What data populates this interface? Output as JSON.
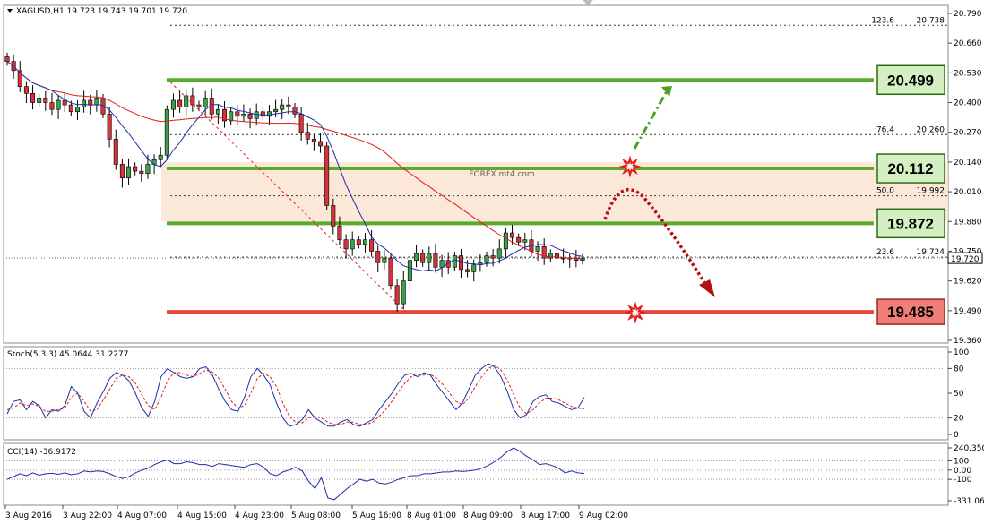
{
  "chart_data": [
    {
      "type": "candlestick",
      "symbol": "XAGUSD,H1",
      "ohlc": "19.723 19.743 19.701 19.720",
      "ylim": [
        19.36,
        20.79
      ],
      "y_ticks": [
        "20.790",
        "20.660",
        "20.530",
        "20.400",
        "20.270",
        "20.140",
        "20.010",
        "19.880",
        "19.750",
        "19.620",
        "19.490",
        "19.360"
      ],
      "x_ticks": [
        "3 Aug 2016",
        "3 Aug 22:00",
        "4 Aug 07:00",
        "4 Aug 15:00",
        "4 Aug 23:00",
        "5 Aug 08:00",
        "5 Aug 16:00",
        "8 Aug 01:00",
        "8 Aug 09:00",
        "8 Aug 17:00",
        "9 Aug 02:00"
      ],
      "current_price": "19.720",
      "fib_levels": [
        {
          "ratio": "123.6",
          "price": "20.738",
          "value": 20.738
        },
        {
          "ratio": "76.4",
          "price": "20.260",
          "value": 20.26
        },
        {
          "ratio": "50.0",
          "price": "19.992",
          "value": 19.992
        },
        {
          "ratio": "23.6",
          "price": "19.724",
          "value": 19.724
        }
      ],
      "resistance_levels": [
        {
          "label": "20.499",
          "value": 20.499,
          "color": "#5aaa2e"
        },
        {
          "label": "20.112",
          "value": 20.112,
          "color": "#5aaa2e"
        },
        {
          "label": "19.872",
          "value": 19.872,
          "color": "#5aaa2e"
        }
      ],
      "support_levels": [
        {
          "label": "19.485",
          "value": 19.485,
          "color": "#e8463e"
        }
      ],
      "zone": [
        19.88,
        20.14
      ],
      "watermark": "FOREX mt4.com",
      "closes": [
        20.58,
        20.54,
        20.47,
        20.44,
        20.4,
        20.42,
        20.4,
        20.37,
        20.41,
        20.39,
        20.36,
        20.38,
        20.41,
        20.39,
        20.42,
        20.35,
        20.24,
        20.13,
        20.07,
        20.12,
        20.1,
        20.09,
        20.13,
        20.15,
        20.17,
        20.37,
        20.41,
        20.38,
        20.43,
        20.39,
        20.38,
        20.42,
        20.35,
        20.37,
        20.32,
        20.36,
        20.34,
        20.35,
        20.33,
        20.36,
        20.34,
        20.36,
        20.37,
        20.39,
        20.38,
        20.35,
        20.27,
        20.24,
        20.23,
        20.21,
        19.95,
        19.86,
        19.8,
        19.76,
        19.8,
        19.78,
        19.8,
        19.75,
        19.7,
        19.72,
        19.6,
        19.52,
        19.62,
        19.71,
        19.74,
        19.7,
        19.74,
        19.68,
        19.71,
        19.68,
        19.73,
        19.67,
        19.66,
        19.69,
        19.7,
        19.73,
        19.72,
        19.76,
        19.83,
        19.81,
        19.79,
        19.8,
        19.75,
        19.77,
        19.72,
        19.74,
        19.72,
        19.72,
        19.72,
        19.71,
        19.72
      ],
      "stoch_label": "Stoch(5,3,3) 45.0644 31.2277",
      "stoch_ticks": [
        "100",
        "80",
        "50",
        "20",
        "0"
      ],
      "stoch_main": [
        25,
        40,
        42,
        30,
        40,
        35,
        20,
        30,
        28,
        35,
        58,
        50,
        28,
        20,
        38,
        52,
        68,
        75,
        72,
        65,
        50,
        32,
        22,
        40,
        70,
        80,
        75,
        70,
        68,
        70,
        80,
        82,
        72,
        55,
        40,
        30,
        28,
        45,
        70,
        80,
        72,
        60,
        38,
        20,
        10,
        12,
        18,
        30,
        20,
        15,
        10,
        10,
        15,
        18,
        12,
        10,
        14,
        18,
        30,
        40,
        50,
        62,
        72,
        74,
        70,
        75,
        72,
        60,
        50,
        40,
        30,
        38,
        55,
        72,
        80,
        86,
        82,
        70,
        52,
        30,
        20,
        24,
        40,
        46,
        48,
        40,
        38,
        34,
        30,
        32,
        45
      ],
      "stoch_signal": [
        30,
        32,
        38,
        35,
        37,
        34,
        28,
        28,
        30,
        32,
        45,
        50,
        40,
        28,
        30,
        42,
        55,
        68,
        72,
        70,
        62,
        48,
        35,
        30,
        45,
        65,
        75,
        75,
        72,
        70,
        74,
        78,
        76,
        68,
        55,
        40,
        32,
        35,
        50,
        68,
        74,
        70,
        58,
        38,
        22,
        15,
        14,
        20,
        22,
        20,
        15,
        12,
        12,
        15,
        15,
        12,
        12,
        15,
        22,
        30,
        40,
        52,
        62,
        70,
        72,
        72,
        73,
        68,
        60,
        50,
        40,
        36,
        44,
        58,
        70,
        80,
        84,
        78,
        66,
        48,
        32,
        25,
        30,
        38,
        44,
        44,
        42,
        38,
        34,
        32,
        31
      ],
      "cci_label": "CCI(14) -36.9172",
      "cci_ticks": [
        "240.3504",
        "100",
        "0.00",
        "-100",
        "-331.0694"
      ],
      "cci_values": [
        -100,
        -70,
        -40,
        -60,
        -30,
        -55,
        -40,
        -35,
        -45,
        -30,
        -50,
        -40,
        -10,
        -20,
        -10,
        -15,
        -40,
        -70,
        -90,
        -70,
        -30,
        0,
        20,
        60,
        90,
        110,
        70,
        70,
        90,
        80,
        60,
        60,
        40,
        70,
        60,
        50,
        40,
        30,
        60,
        70,
        30,
        -40,
        -60,
        -20,
        0,
        30,
        -10,
        -120,
        -200,
        -80,
        -300,
        -320,
        -260,
        -200,
        -150,
        -100,
        -120,
        -100,
        -140,
        -150,
        -130,
        -100,
        -80,
        -60,
        -60,
        -40,
        -40,
        -30,
        -20,
        -20,
        -10,
        -15,
        -10,
        0,
        20,
        50,
        90,
        140,
        200,
        240,
        200,
        150,
        110,
        60,
        70,
        50,
        20,
        -30,
        -10,
        -30,
        -37
      ]
    }
  ]
}
